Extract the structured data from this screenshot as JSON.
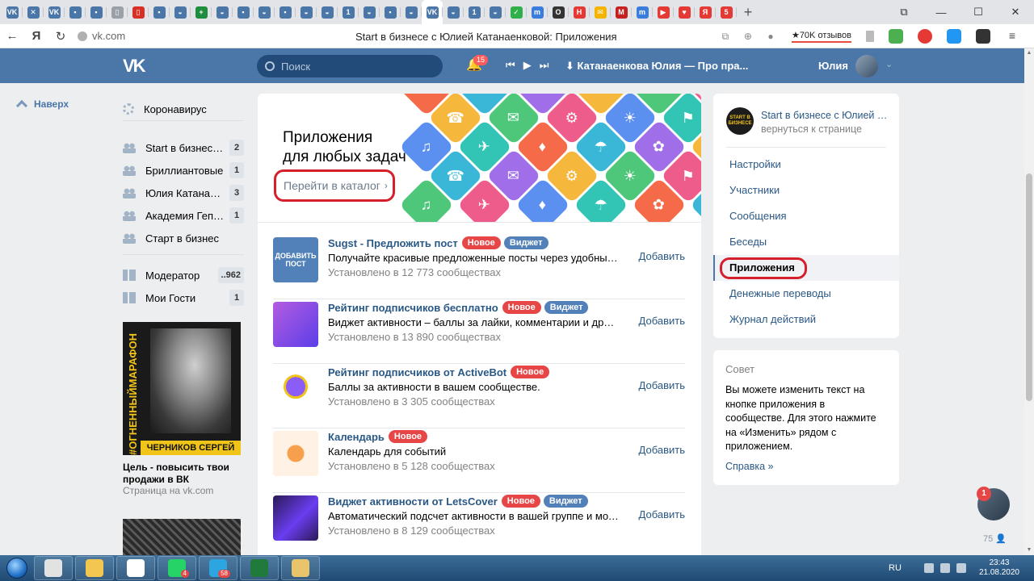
{
  "browser": {
    "tabs": [
      {
        "label": "vk",
        "color": "#4a76a8",
        "glyph": "VK"
      },
      {
        "label": "x",
        "color": "#4a76a8",
        "glyph": "✕"
      },
      {
        "label": "vk",
        "color": "#4a76a8",
        "glyph": "VK"
      },
      {
        "label": "doc",
        "color": "#4a76a8",
        "glyph": "▪"
      },
      {
        "label": "doc",
        "color": "#4a76a8",
        "glyph": "▪"
      },
      {
        "label": "file",
        "color": "#9aa0a6",
        "glyph": "▯"
      },
      {
        "label": "pdf",
        "color": "#d93025",
        "glyph": "▯"
      },
      {
        "label": "doc",
        "color": "#4a76a8",
        "glyph": "▪"
      },
      {
        "label": "web",
        "color": "#4a76a8",
        "glyph": "◒"
      },
      {
        "label": "plus",
        "color": "#1e8e3e",
        "glyph": "+"
      },
      {
        "label": "web",
        "color": "#4a76a8",
        "glyph": "◒"
      },
      {
        "label": "doc",
        "color": "#4a76a8",
        "glyph": "▪"
      },
      {
        "label": "web",
        "color": "#4a76a8",
        "glyph": "◒"
      },
      {
        "label": "doc",
        "color": "#4a76a8",
        "glyph": "▪"
      },
      {
        "label": "web",
        "color": "#4a76a8",
        "glyph": "◒"
      },
      {
        "label": "web",
        "color": "#4a76a8",
        "glyph": "◒"
      },
      {
        "label": "one",
        "color": "#4a76a8",
        "glyph": "1"
      },
      {
        "label": "web",
        "color": "#4a76a8",
        "glyph": "◒"
      },
      {
        "label": "doc",
        "color": "#4a76a8",
        "glyph": "▪"
      },
      {
        "label": "web",
        "color": "#4a76a8",
        "glyph": "◒"
      },
      {
        "label": "vk",
        "color": "#4a76a8",
        "glyph": "VK",
        "active": true
      },
      {
        "label": "web",
        "color": "#4a76a8",
        "glyph": "◒"
      },
      {
        "label": "one",
        "color": "#4a76a8",
        "glyph": "1"
      },
      {
        "label": "web",
        "color": "#4a76a8",
        "glyph": "◒"
      },
      {
        "label": "check",
        "color": "#2fb04b",
        "glyph": "✓"
      },
      {
        "label": "m",
        "color": "#3b7ddd",
        "glyph": "m"
      },
      {
        "label": "o",
        "color": "#333333",
        "glyph": "O"
      },
      {
        "label": "h",
        "color": "#e53935",
        "glyph": "H"
      },
      {
        "label": "mail",
        "color": "#f4b400",
        "glyph": "✉"
      },
      {
        "label": "gmail",
        "color": "#c5221f",
        "glyph": "M"
      },
      {
        "label": "m",
        "color": "#3b7ddd",
        "glyph": "m"
      },
      {
        "label": "youtube",
        "color": "#e53935",
        "glyph": "▶"
      },
      {
        "label": "heart",
        "color": "#e53935",
        "glyph": "♥"
      },
      {
        "label": "yandex",
        "color": "#e53935",
        "glyph": "Я"
      },
      {
        "label": "five",
        "color": "#e53935",
        "glyph": "5"
      }
    ],
    "new_tab": "+",
    "url": "vk.com",
    "page_title": "Start в бизнесе с Юлией Катанаенковой: Приложения",
    "reviews": "70K отзывов"
  },
  "header": {
    "search_placeholder": "Поиск",
    "notifications": "15",
    "track": "Катанаенкова Юлия — Про пра...",
    "username": "Юлия"
  },
  "left_nav": {
    "up_label": "Наверх"
  },
  "sidebar": {
    "items": [
      {
        "label": "Коронавирус",
        "count": "",
        "icon": "virus-icon"
      },
      {
        "label": "Start в бизнесе с Юлией Катанаенковой",
        "count": "2",
        "icon": "group-icon"
      },
      {
        "label": "Бриллиантовые",
        "count": "1",
        "icon": "group-icon"
      },
      {
        "label": "Юлия Катанаенкова",
        "count": "3",
        "icon": "group-icon"
      },
      {
        "label": "Академия Гепарда",
        "count": "1",
        "icon": "group-icon"
      },
      {
        "label": "Старт в бизнес",
        "count": "",
        "icon": "group-icon"
      },
      {
        "label": "Модератор",
        "count": "..962",
        "icon": "apps-icon"
      },
      {
        "label": "Мои Гости",
        "count": "1",
        "icon": "apps-icon"
      }
    ],
    "promo": {
      "vertical_text": "#ОГНЕННЫЙМАРАФОН",
      "name_text": "ЧЕРНИКОВ СЕРГЕЙ",
      "title": "Цель - повысить твои продажи в ВК",
      "subtitle": "Страница на vk.com"
    }
  },
  "main": {
    "banner_title_1": "Приложения",
    "banner_title_2": "для любых задач",
    "catalog_link": "Перейти в каталог",
    "add_label": "Добавить",
    "badge_new": "Новое",
    "badge_widget": "Виджет",
    "apps": [
      {
        "name": "Sugst - Предложить пост",
        "badges": [
          "new",
          "widget"
        ],
        "desc": "Получайте красивые предложенные посты через удобный виджет",
        "installed": "Установлено в 12 773 сообществах",
        "icon_text": "ДОБАВИТЬ ПОСТ",
        "icon_color": "#5181b8"
      },
      {
        "name": "Рейтинг подписчиков бесплатно",
        "badges": [
          "new",
          "widget"
        ],
        "desc": "Виджет активности – баллы за лайки, комментарии и другие действия",
        "installed": "Установлено в 13 890 сообществах",
        "icon_text": "",
        "icon_color": "#8e44c8"
      },
      {
        "name": "Рейтинг подписчиков от ActiveBot",
        "badges": [
          "new"
        ],
        "desc": "Баллы за активности в вашем сообществе.",
        "installed": "Установлено в 3 305 сообществах",
        "icon_text": "",
        "icon_color": "#ffffff"
      },
      {
        "name": "Календарь",
        "badges": [
          "new"
        ],
        "desc": "Календарь для событий",
        "installed": "Установлено в 5 128 сообществах",
        "icon_text": "",
        "icon_color": "#fff1e3"
      },
      {
        "name": "Виджет активности от LetsCover",
        "badges": [
          "new",
          "widget"
        ],
        "desc": "Автоматический подсчет активности в вашей группе и мотивация",
        "installed": "Установлено в 8 129 сообществах",
        "icon_text": "",
        "icon_color": "#2a1a55"
      }
    ]
  },
  "right_menu": {
    "group_avatar_text": "START В БИЗНЕСЕ",
    "group_name": "Start в бизнесе с Юлией Катанаенковой",
    "back_link": "вернуться к странице",
    "items": [
      "Настройки",
      "Участники",
      "Сообщения",
      "Беседы",
      "Приложения",
      "Денежные переводы",
      "Журнал действий"
    ],
    "active_index": 4
  },
  "tip": {
    "heading": "Совет",
    "body": "Вы можете изменить текст на кнопке приложения в сообществе. Для этого нажмите на «Изменить» рядом с приложением.",
    "link": "Справка »"
  },
  "chat": {
    "badge": "1",
    "online": "75"
  },
  "taskbar": {
    "lang": "RU",
    "time": "23:43",
    "date": "21.08.2020",
    "apps": [
      {
        "name": "chrome-task",
        "color": "#e2e2e2",
        "badge": ""
      },
      {
        "name": "explorer-task",
        "color": "#f3c74f",
        "badge": ""
      },
      {
        "name": "yandex-task",
        "color": "#ffffff",
        "badge": ""
      },
      {
        "name": "whatsapp-task",
        "color": "#25d366",
        "badge": "4"
      },
      {
        "name": "telegram-task",
        "color": "#2ca5e0",
        "badge": "58"
      },
      {
        "name": "excel-task",
        "color": "#1f7a3c",
        "badge": ""
      },
      {
        "name": "paint-task",
        "color": "#e9c46a",
        "badge": ""
      }
    ]
  }
}
